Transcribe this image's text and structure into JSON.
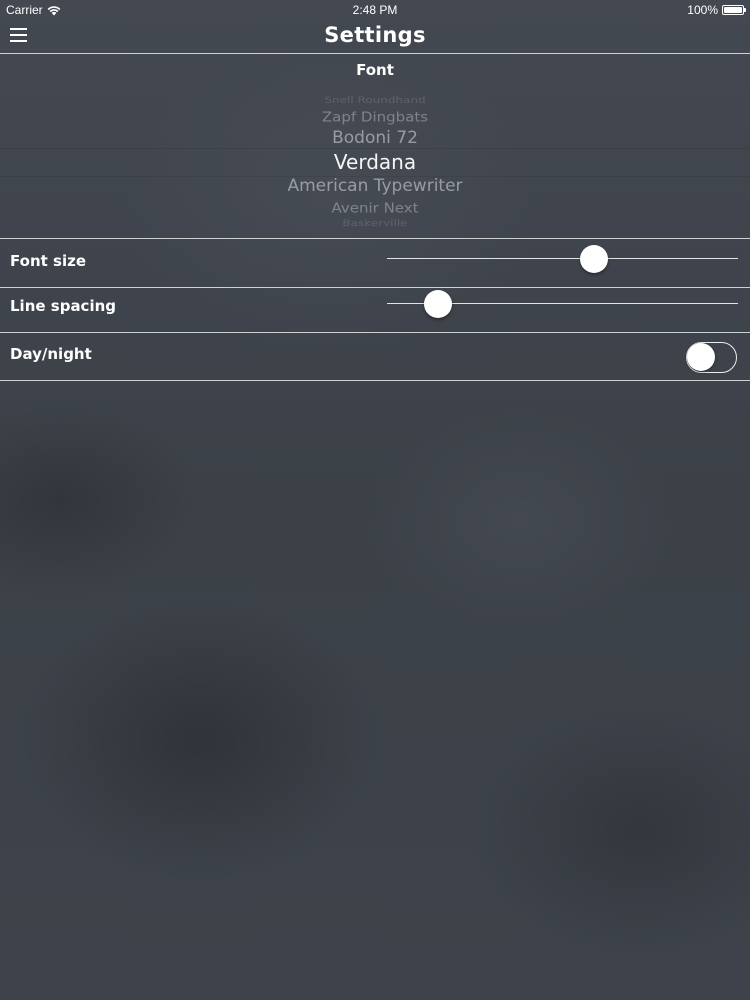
{
  "status_bar": {
    "carrier": "Carrier",
    "time": "2:48 PM",
    "battery": "100%"
  },
  "nav": {
    "title": "Settings",
    "menu_icon": "menu-icon"
  },
  "font_section": {
    "title": "Font",
    "picker_items": [
      "Snell Roundhand",
      "Zapf Dingbats",
      "Bodoni 72",
      "Verdana",
      "American Typewriter",
      "Avenir Next",
      "Baskerville"
    ],
    "selected": "Verdana"
  },
  "settings": {
    "font_size": {
      "label": "Font size",
      "value_fraction": 0.59
    },
    "line_spacing": {
      "label": "Line spacing",
      "value_fraction": 0.145
    },
    "day_night": {
      "label": "Day/night",
      "on": false
    }
  },
  "colors": {
    "background": "#3f444c",
    "foreground": "#ffffff"
  }
}
